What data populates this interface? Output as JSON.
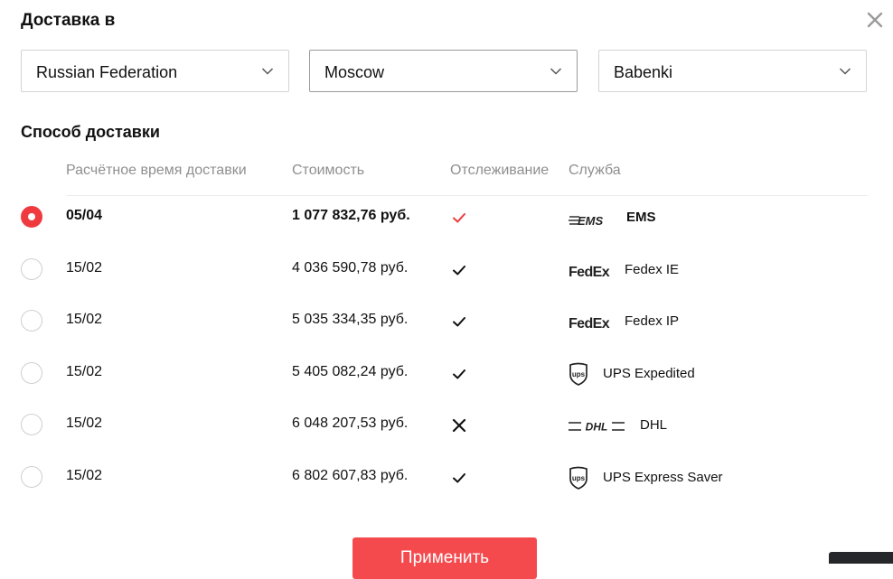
{
  "header": {
    "title": "Доставка в"
  },
  "location": {
    "country": "Russian Federation",
    "city": "Moscow",
    "district": "Babenki"
  },
  "shipping": {
    "section_title": "Способ доставки",
    "columns": {
      "delivery_time": "Расчётное время доставки",
      "cost": "Стоимость",
      "tracking": "Отслеживание",
      "service": "Служба"
    },
    "rows": [
      {
        "date": "05/04",
        "price": "1 077 832,76 руб.",
        "tracking": true,
        "service": "EMS",
        "logo": "ems-logo",
        "selected": true
      },
      {
        "date": "15/02",
        "price": "4 036 590,78 руб.",
        "tracking": true,
        "service": "Fedex IE",
        "logo": "fedex-logo",
        "selected": false
      },
      {
        "date": "15/02",
        "price": "5 035 334,35 руб.",
        "tracking": true,
        "service": "Fedex IP",
        "logo": "fedex-logo",
        "selected": false
      },
      {
        "date": "15/02",
        "price": "5 405 082,24 руб.",
        "tracking": true,
        "service": "UPS Expedited",
        "logo": "ups-logo",
        "selected": false
      },
      {
        "date": "15/02",
        "price": "6 048 207,53 руб.",
        "tracking": false,
        "service": "DHL",
        "logo": "dhl-logo",
        "selected": false
      },
      {
        "date": "15/02",
        "price": "6 802 607,83 руб.",
        "tracking": true,
        "service": "UPS Express Saver",
        "logo": "ups-logo",
        "selected": false
      }
    ]
  },
  "actions": {
    "apply_label": "Применить"
  },
  "colors": {
    "accent": "#f44a4e",
    "check_selected": "#ef3b3f",
    "muted_text": "#8f8f8f",
    "border": "#d4d4d4"
  }
}
